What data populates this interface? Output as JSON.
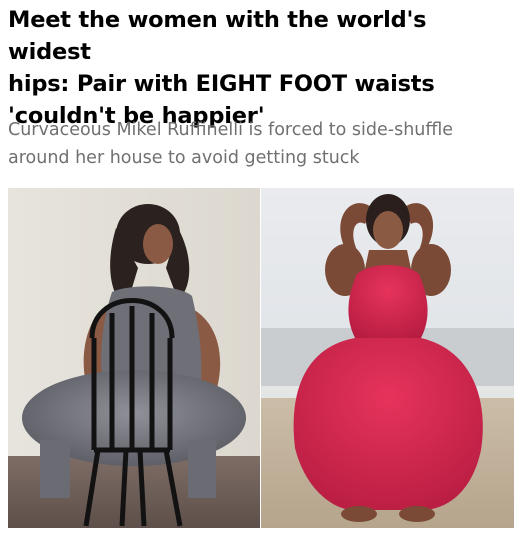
{
  "article": {
    "headline_line1": "Meet the women with the world's widest",
    "headline_line2": "hips: Pair with EIGHT FOOT waists",
    "headline_line3": "'couldn't be happier'",
    "standfirst_line1": "Curvaceous Mikel Ruffinelli is forced to side-shuffle",
    "standfirst_line2": "around her house to avoid getting stuck"
  },
  "images": {
    "left_photo": "woman-seated-on-chair-photo",
    "right_photo": "woman-in-red-dress-on-beach-photo"
  }
}
